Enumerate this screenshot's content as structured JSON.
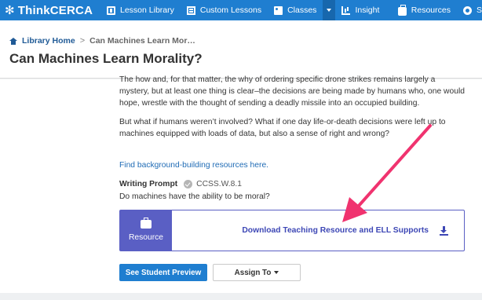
{
  "topnav": {
    "brand": "ThinkCERCA",
    "items": [
      {
        "label": "Lesson Library",
        "icon": "book-icon"
      },
      {
        "label": "Custom Lessons",
        "icon": "newspaper-icon"
      },
      {
        "label": "Classes",
        "icon": "classes-icon"
      },
      {
        "label": "Insight",
        "icon": "chart-icon"
      },
      {
        "label": "Resources",
        "icon": "briefcase-icon"
      },
      {
        "label": "S",
        "icon": "gear-icon"
      }
    ]
  },
  "breadcrumb": {
    "home": "Library Home",
    "separator": ">",
    "current": "Can Machines Learn Mor…"
  },
  "page": {
    "title": "Can Machines Learn Morality?"
  },
  "article": {
    "para1": "The how and, for that matter, the why of ordering specific drone strikes remains largely a mystery, but at least one thing is clear–the decisions are being made by humans who, one would hope, wrestle with the thought of sending a deadly missile into an occupied building.",
    "para2": "But what if humans weren’t involved? What if one day life-or-death decisions were left up to machines equipped with loads of data, but also a sense of right and wrong?",
    "background_link": "Find background-building resources here."
  },
  "writing_prompt": {
    "label": "Writing Prompt",
    "standard": "CCSS.W.8.1",
    "question": "Do machines have the ability to be moral?"
  },
  "resource": {
    "tab_label": "Resource",
    "download_label": "Download Teaching Resource and ELL Supports"
  },
  "actions": {
    "preview": "See Student Preview",
    "assign": "Assign To"
  },
  "colors": {
    "topbar": "#1f7ed0",
    "resource_accent": "#5a5fc4",
    "annotation_arrow": "#f0336f"
  }
}
